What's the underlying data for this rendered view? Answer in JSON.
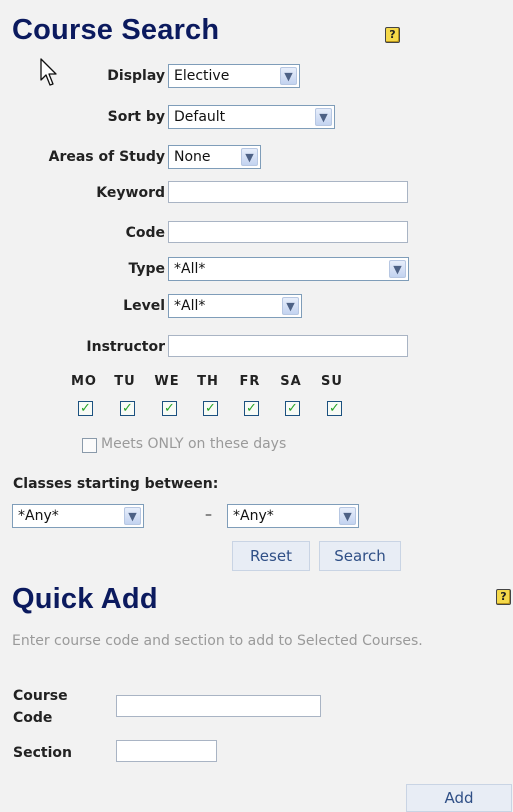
{
  "course_search": {
    "title": "Course Search",
    "help_glyph": "?",
    "fields": {
      "display": {
        "label": "Display",
        "value": "Elective"
      },
      "sort_by": {
        "label": "Sort by",
        "value": "Default"
      },
      "areas_of_study": {
        "label": "Areas of Study",
        "value": "None"
      },
      "keyword": {
        "label": "Keyword",
        "value": ""
      },
      "code": {
        "label": "Code",
        "value": ""
      },
      "type": {
        "label": "Type",
        "value": "*All*"
      },
      "level": {
        "label": "Level",
        "value": "*All*"
      },
      "instructor": {
        "label": "Instructor",
        "value": ""
      }
    },
    "days": [
      {
        "label": "MO",
        "checked": true
      },
      {
        "label": "TU",
        "checked": true
      },
      {
        "label": "WE",
        "checked": true
      },
      {
        "label": "TH",
        "checked": true
      },
      {
        "label": "FR",
        "checked": true
      },
      {
        "label": "SA",
        "checked": true
      },
      {
        "label": "SU",
        "checked": true
      }
    ],
    "meets_only": {
      "label": "Meets ONLY on these days",
      "checked": false
    },
    "start_between": {
      "label": "Classes starting between:",
      "from": "*Any*",
      "separator": "–",
      "to": "*Any*"
    },
    "reset_label": "Reset",
    "search_label": "Search"
  },
  "quick_add": {
    "title": "Quick Add",
    "help_glyph": "?",
    "instructions": "Enter course code and section to add to Selected Courses.",
    "course_code_label_line1": "Course",
    "course_code_label_line2": "Code",
    "course_code_value": "",
    "section_label": "Section",
    "section_value": "",
    "add_label": "Add"
  },
  "colors": {
    "heading": "#0b1a5e",
    "background": "#f2f2f2",
    "button_text": "#2f4f86",
    "check": "#26a326"
  },
  "icons": [
    "mouse-cursor-icon",
    "help-icon",
    "chevron-down-icon",
    "checkmark-icon"
  ]
}
